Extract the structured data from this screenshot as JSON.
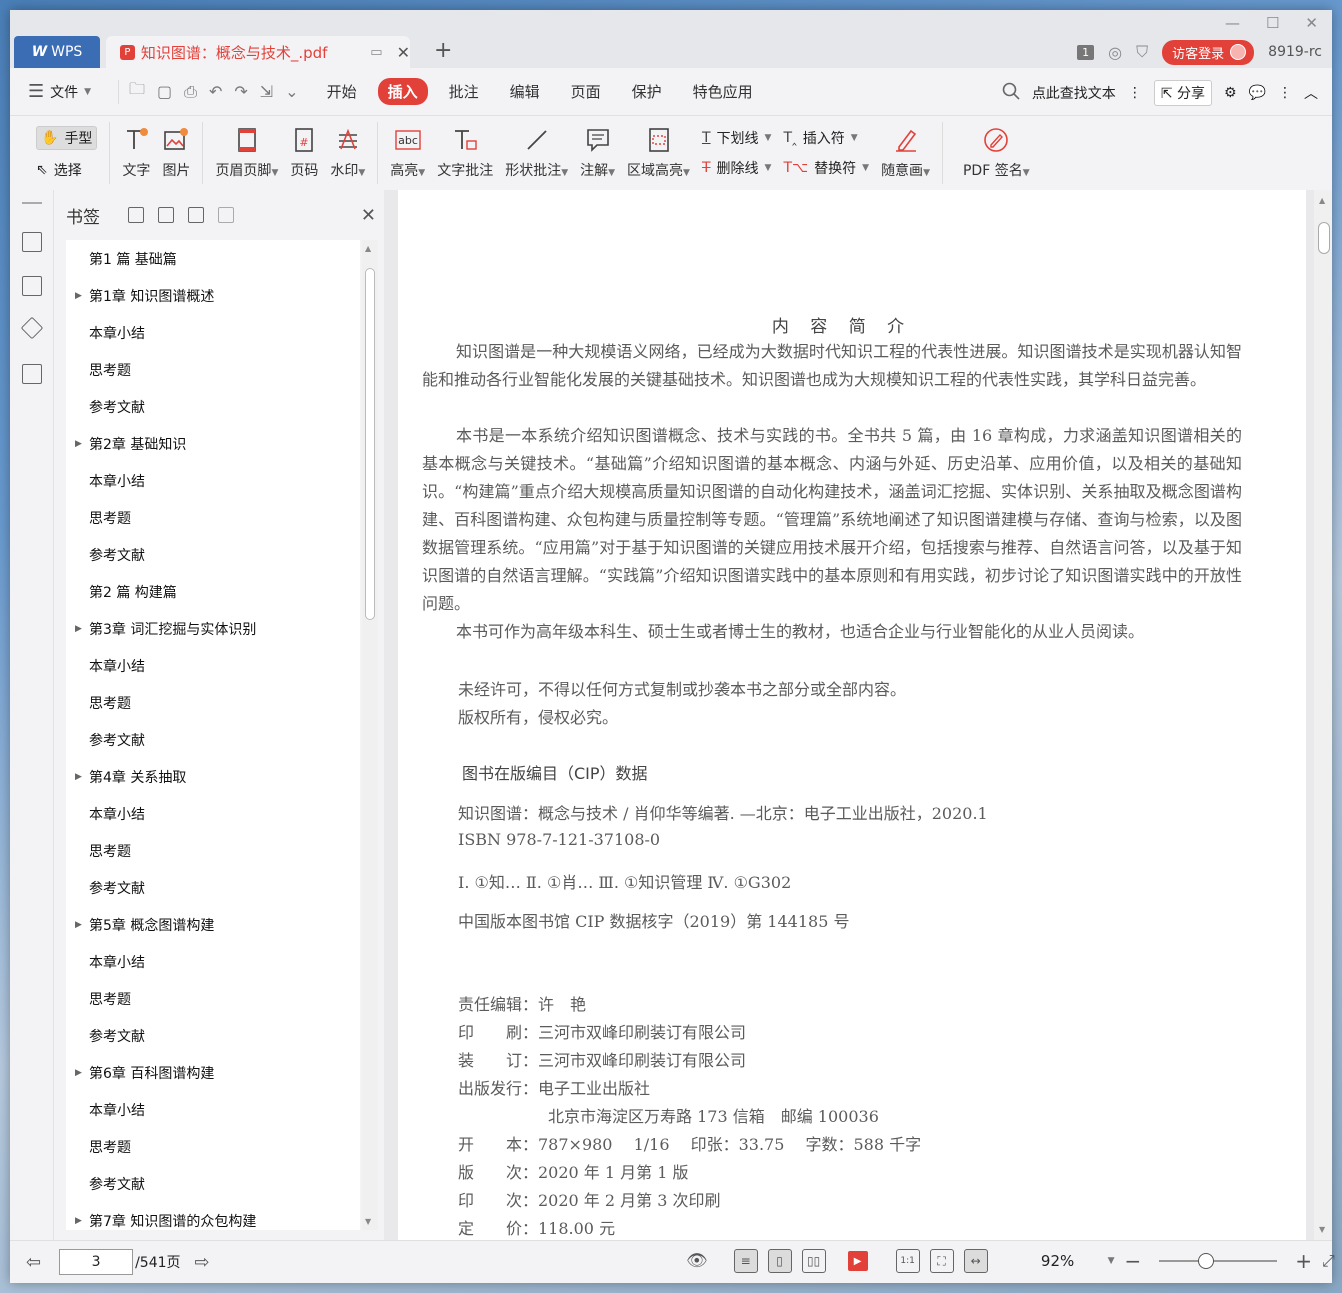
{
  "titlebar": {
    "app_label": "WPS",
    "doc_tab_title": "知识图谱：概念与技术_.pdf",
    "new_tab": "+",
    "page_badge": "1",
    "login_label": "访客登录",
    "user": "8919-rc"
  },
  "menubar": {
    "file_label": "文件",
    "tabs": [
      "开始",
      "插入",
      "批注",
      "编辑",
      "页面",
      "保护",
      "特色应用"
    ],
    "active_tab": "插入",
    "search_label": "点此查找文本",
    "share_label": "分享"
  },
  "ribbon": {
    "hand_label": "手型",
    "select_label": "选择",
    "text_label": "文字",
    "image_label": "图片",
    "header_footer_label": "页眉页脚",
    "page_no_label": "页码",
    "watermark_label": "水印",
    "highlight_label": "高亮",
    "text_comment_label": "文字批注",
    "shape_comment_label": "形状批注",
    "note_label": "注解",
    "area_highlight_label": "区域高亮",
    "underline_label": "下划线",
    "strikethrough_label": "删除线",
    "insert_mark_label": "插入符",
    "replace_mark_label": "替换符",
    "freehand_label": "随意画",
    "pdf_sign_label": "PDF 签名"
  },
  "bookmarks": {
    "title": "书签",
    "items": [
      {
        "label": "第1 篇 基础篇",
        "expandable": false
      },
      {
        "label": "第1章 知识图谱概述",
        "expandable": true
      },
      {
        "label": "本章小结",
        "expandable": false
      },
      {
        "label": "思考题",
        "expandable": false
      },
      {
        "label": "参考文献",
        "expandable": false
      },
      {
        "label": "第2章 基础知识",
        "expandable": true
      },
      {
        "label": "本章小结",
        "expandable": false
      },
      {
        "label": "思考题",
        "expandable": false
      },
      {
        "label": "参考文献",
        "expandable": false
      },
      {
        "label": "第2 篇 构建篇",
        "expandable": false
      },
      {
        "label": "第3章 词汇挖掘与实体识别",
        "expandable": true
      },
      {
        "label": "本章小结",
        "expandable": false
      },
      {
        "label": "思考题",
        "expandable": false
      },
      {
        "label": "参考文献",
        "expandable": false
      },
      {
        "label": "第4章 关系抽取",
        "expandable": true
      },
      {
        "label": "本章小结",
        "expandable": false
      },
      {
        "label": "思考题",
        "expandable": false
      },
      {
        "label": "参考文献",
        "expandable": false
      },
      {
        "label": "第5章 概念图谱构建",
        "expandable": true
      },
      {
        "label": "本章小结",
        "expandable": false
      },
      {
        "label": "思考题",
        "expandable": false
      },
      {
        "label": "参考文献",
        "expandable": false
      },
      {
        "label": "第6章 百科图谱构建",
        "expandable": true
      },
      {
        "label": "本章小结",
        "expandable": false
      },
      {
        "label": "思考题",
        "expandable": false
      },
      {
        "label": "参考文献",
        "expandable": false
      },
      {
        "label": "第7章 知识图谱的众包构建",
        "expandable": true
      }
    ]
  },
  "document": {
    "heading": "内 容 简 介",
    "para1": "知识图谱是一种大规模语义网络，已经成为大数据时代知识工程的代表性进展。知识图谱技术是实现机器认知智能和推动各行业智能化发展的关键基础技术。知识图谱也成为大规模知识工程的代表性实践，其学科日益完善。",
    "para2": "本书是一本系统介绍知识图谱概念、技术与实践的书。全书共 5 篇，由 16 章构成，力求涵盖知识图谱相关的基本概念与关键技术。“基础篇”介绍知识图谱的基本概念、内涵与外延、历史沿革、应用价值，以及相关的基础知识。“构建篇”重点介绍大规模高质量知识图谱的自动化构建技术，涵盖词汇挖掘、实体识别、关系抽取及概念图谱构建、百科图谱构建、众包构建与质量控制等专题。“管理篇”系统地阐述了知识图谱建模与存储、查询与检索，以及图数据管理系统。“应用篇”对于基于知识图谱的关键应用技术展开介绍，包括搜索与推荐、自然语言问答，以及基于知识图谱的自然语言理解。“实践篇”介绍知识图谱实践中的基本原则和有用实践，初步讨论了知识图谱实践中的开放性问题。",
    "para3": "本书可作为高年级本科生、硕士生或者博士生的教材，也适合企业与行业智能化的从业人员阅读。",
    "notice1": "未经许可，不得以任何方式复制或抄袭本书之部分或全部内容。",
    "notice2": "版权所有，侵权必究。",
    "cip_title": "图书在版编目（CIP）数据",
    "cip1": "知识图谱：概念与技术 / 肖仰华等编著. —北京：电子工业出版社，2020.1",
    "cip2": "ISBN 978-7-121-37108-0",
    "cip3": "Ⅰ. ①知… Ⅱ. ①肖… Ⅲ. ①知识管理 Ⅳ. ①G302",
    "cip4": "中国版本图书馆 CIP 数据核字（2019）第 144185 号",
    "editor": "责任编辑：许　艳",
    "printer": "印　　刷：三河市双峰印刷装订有限公司",
    "binder": "装　　订：三河市双峰印刷装订有限公司",
    "publisher": "出版发行：电子工业出版社",
    "address": "北京市海淀区万寿路 173 信箱　邮编 100036",
    "format": "开　　本：787×980　 1/16　 印张：33.75　 字数：588 千字",
    "edition": "版　　次：2020 年 1 月第 1 版",
    "impression": "印　　次：2020 年 2 月第 3 次印刷",
    "price": "定　　价：118.00 元"
  },
  "statusbar": {
    "current_page": "3",
    "total_pages": "/541页",
    "zoom": "92%",
    "zoom_level_fraction": 0.4
  },
  "colors": {
    "accent": "#e2413a",
    "wps_blue": "#3b6db5"
  }
}
